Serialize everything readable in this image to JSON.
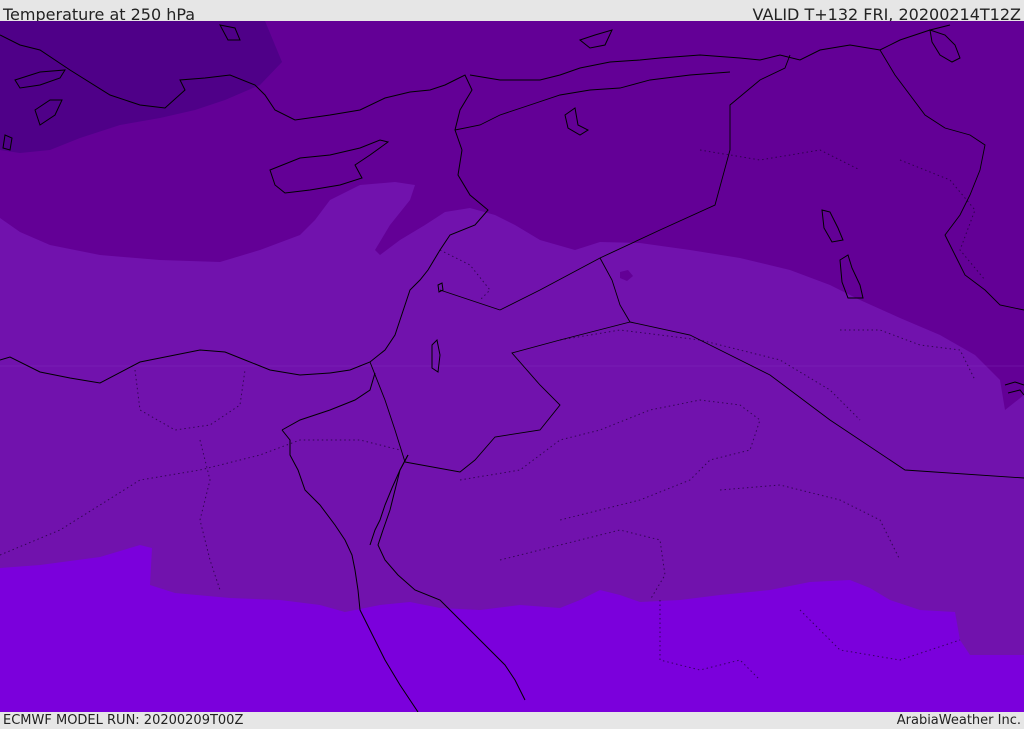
{
  "header": {
    "title": "Temperature at 250 hPa",
    "valid": "VALID T+132 FRI, 20200214T12Z"
  },
  "footer": {
    "model_run": "ECMWF MODEL RUN: 20200209T00Z",
    "credit": "ArabiaWeather Inc."
  },
  "colors": {
    "band_coldest": "#4f0088",
    "band_cold": "#630096",
    "band_mid": "#7112ad",
    "band_warm": "#7b00dc",
    "coastline": "#000000",
    "header_bg": "#e6e6e6"
  }
}
